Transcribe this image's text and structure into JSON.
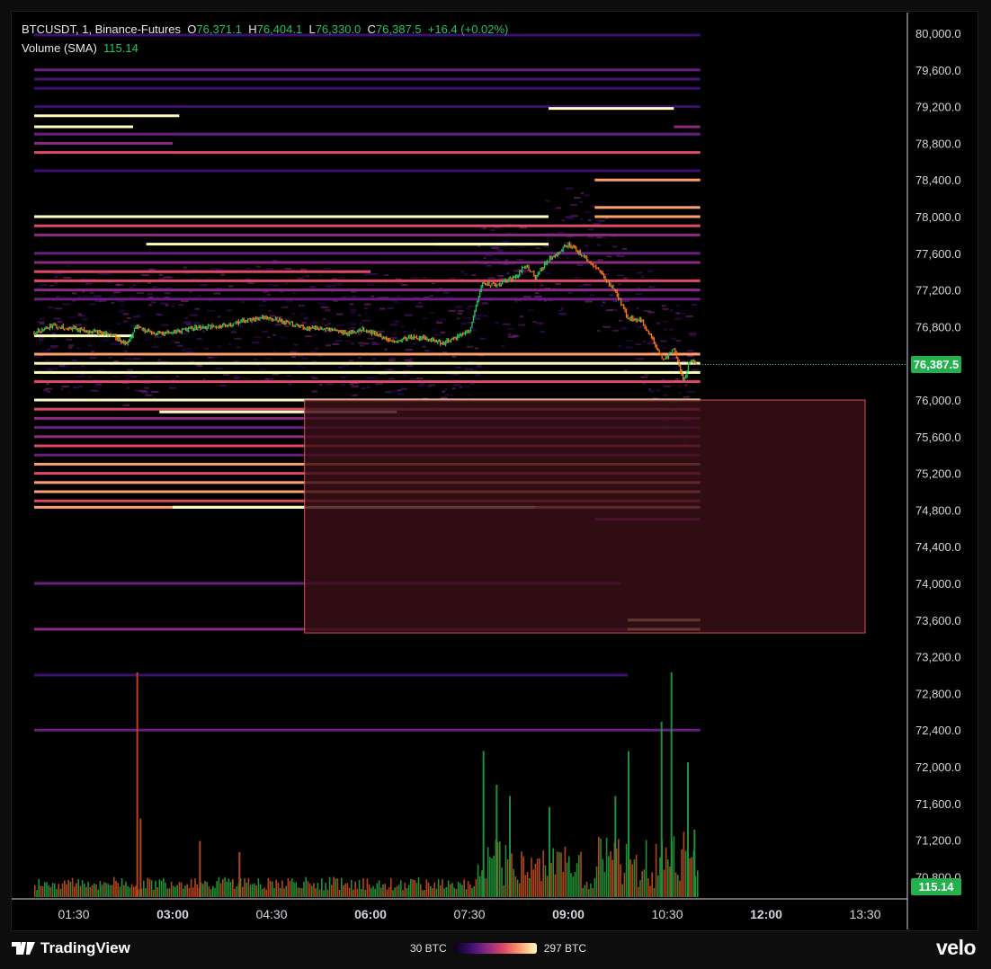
{
  "legend": {
    "symbol": "BTCUSDT, 1, Binance-Futures",
    "o_label": "O",
    "o_value": "76,371.1",
    "h_label": "H",
    "h_value": "76,404.1",
    "l_label": "L",
    "l_value": "76,330.0",
    "c_label": "C",
    "c_value": "76,387.5",
    "change": "+16.4 (+0.02%)",
    "volume_label": "Volume (SMA)",
    "volume_value": "115.14"
  },
  "price_tag": "76,387.5",
  "volume_tag": "115.14",
  "footer": {
    "brand": "TradingView",
    "scale_min": "30 BTC",
    "scale_max": "297 BTC",
    "watermark": "velo"
  },
  "colors": {
    "up": "#22c55e",
    "down": "#f97316",
    "zone_fill": "#3a0f17",
    "zone_border": "#d9534f"
  },
  "chart_data": {
    "type": "candlestick-heatmap",
    "y_ticks": [
      "80,000.0",
      "79,600.0",
      "79,200.0",
      "78,800.0",
      "78,400.0",
      "78,000.0",
      "77,600.0",
      "77,200.0",
      "76,800.0",
      "76,400.0",
      "76,000.0",
      "75,600.0",
      "75,200.0",
      "74,800.0",
      "74,400.0",
      "74,000.0",
      "73,600.0",
      "73,200.0",
      "72,800.0",
      "72,400.0",
      "72,000.0",
      "71,600.0",
      "71,200.0",
      "70,800.0"
    ],
    "x_ticks": [
      {
        "label": "01:30",
        "bold": false
      },
      {
        "label": "03:00",
        "bold": true
      },
      {
        "label": "04:30",
        "bold": false
      },
      {
        "label": "06:00",
        "bold": true
      },
      {
        "label": "07:30",
        "bold": false
      },
      {
        "label": "09:00",
        "bold": true
      },
      {
        "label": "10:30",
        "bold": false
      },
      {
        "label": "12:00",
        "bold": true
      },
      {
        "label": "13:30",
        "bold": false
      }
    ],
    "x_hours": [
      1.5,
      3,
      4.5,
      6,
      7.5,
      9,
      10.5,
      12,
      13.5
    ],
    "y_range": [
      70600,
      80100
    ],
    "last_close": 76387.5,
    "price_path": [
      [
        0.9,
        76740
      ],
      [
        1.2,
        76810
      ],
      [
        1.5,
        76780
      ],
      [
        1.8,
        76750
      ],
      [
        2.1,
        76700
      ],
      [
        2.3,
        76610
      ],
      [
        2.45,
        76800
      ],
      [
        2.7,
        76720
      ],
      [
        3.0,
        76740
      ],
      [
        3.3,
        76790
      ],
      [
        3.7,
        76800
      ],
      [
        4.0,
        76850
      ],
      [
        4.4,
        76910
      ],
      [
        4.7,
        76850
      ],
      [
        5.0,
        76790
      ],
      [
        5.3,
        76780
      ],
      [
        5.6,
        76730
      ],
      [
        5.9,
        76770
      ],
      [
        6.1,
        76720
      ],
      [
        6.3,
        76630
      ],
      [
        6.6,
        76680
      ],
      [
        6.9,
        76670
      ],
      [
        7.1,
        76620
      ],
      [
        7.3,
        76680
      ],
      [
        7.5,
        76760
      ],
      [
        7.7,
        77280
      ],
      [
        7.9,
        77250
      ],
      [
        8.2,
        77340
      ],
      [
        8.35,
        77470
      ],
      [
        8.5,
        77350
      ],
      [
        8.7,
        77530
      ],
      [
        8.9,
        77640
      ],
      [
        9.0,
        77700
      ],
      [
        9.3,
        77520
      ],
      [
        9.5,
        77380
      ],
      [
        9.7,
        77200
      ],
      [
        9.9,
        76900
      ],
      [
        10.1,
        76870
      ],
      [
        10.3,
        76640
      ],
      [
        10.45,
        76420
      ],
      [
        10.6,
        76560
      ],
      [
        10.75,
        76200
      ],
      [
        10.85,
        76450
      ],
      [
        10.95,
        76390
      ]
    ],
    "zone": {
      "x_start_hour": 5.0,
      "x_end_hour": 13.5,
      "price_top": 76000,
      "price_bottom": 73460
    },
    "current_price_line": 76387.5,
    "liquidity_levels": [
      {
        "price": 79980,
        "from": 0.9,
        "to": 11.0,
        "color": "#3b0f70"
      },
      {
        "price": 79600,
        "from": 0.9,
        "to": 11.0,
        "color": "#6a1f80"
      },
      {
        "price": 79500,
        "from": 0.9,
        "to": 11.0,
        "color": "#4a1372"
      },
      {
        "price": 79400,
        "from": 0.9,
        "to": 11.0,
        "color": "#3b0f70"
      },
      {
        "price": 79200,
        "from": 0.9,
        "to": 11.0,
        "color": "#3b0f70"
      },
      {
        "price": 79180,
        "from": 8.7,
        "to": 10.6,
        "color": "#fcfdbf"
      },
      {
        "price": 79100,
        "from": 0.9,
        "to": 3.1,
        "color": "#fcfdbf"
      },
      {
        "price": 78980,
        "from": 0.9,
        "to": 2.4,
        "color": "#fcfdbf"
      },
      {
        "price": 78980,
        "from": 10.6,
        "to": 11.0,
        "color": "#8c2981"
      },
      {
        "price": 78900,
        "from": 0.9,
        "to": 11.0,
        "color": "#6a1f80"
      },
      {
        "price": 78800,
        "from": 0.9,
        "to": 3.0,
        "color": "#8c2981"
      },
      {
        "price": 78700,
        "from": 0.9,
        "to": 11.0,
        "color": "#de4968"
      },
      {
        "price": 78500,
        "from": 0.9,
        "to": 11.0,
        "color": "#3b0f70"
      },
      {
        "price": 78400,
        "from": 9.4,
        "to": 11.0,
        "color": "#fe9f6d"
      },
      {
        "price": 78100,
        "from": 9.4,
        "to": 11.0,
        "color": "#fe9f6d"
      },
      {
        "price": 78000,
        "from": 0.9,
        "to": 8.7,
        "color": "#fcfdbf"
      },
      {
        "price": 78000,
        "from": 9.4,
        "to": 11.0,
        "color": "#fe9f6d"
      },
      {
        "price": 77900,
        "from": 0.9,
        "to": 11.0,
        "color": "#de4968"
      },
      {
        "price": 77800,
        "from": 0.9,
        "to": 11.0,
        "color": "#8c2981"
      },
      {
        "price": 77700,
        "from": 2.6,
        "to": 8.7,
        "color": "#fcfdbf"
      },
      {
        "price": 77700,
        "from": 7.0,
        "to": 8.5,
        "color": "#fcfdbf"
      },
      {
        "price": 77600,
        "from": 0.9,
        "to": 11.0,
        "color": "#6a1f80"
      },
      {
        "price": 77500,
        "from": 0.9,
        "to": 11.0,
        "color": "#8c2981"
      },
      {
        "price": 77400,
        "from": 0.9,
        "to": 6.0,
        "color": "#de4968"
      },
      {
        "price": 77300,
        "from": 0.9,
        "to": 11.0,
        "color": "#de4968"
      },
      {
        "price": 77200,
        "from": 0.9,
        "to": 11.0,
        "color": "#8c2981"
      },
      {
        "price": 77100,
        "from": 0.9,
        "to": 11.0,
        "color": "#6a1f80"
      },
      {
        "price": 76700,
        "from": 0.9,
        "to": 2.4,
        "color": "#fcfdbf"
      },
      {
        "price": 76500,
        "from": 0.9,
        "to": 11.0,
        "color": "#fe9f6d"
      },
      {
        "price": 76400,
        "from": 0.9,
        "to": 11.0,
        "color": "#fcfdbf"
      },
      {
        "price": 76300,
        "from": 0.9,
        "to": 11.0,
        "color": "#fcfdbf"
      },
      {
        "price": 76200,
        "from": 0.9,
        "to": 11.0,
        "color": "#de4968"
      },
      {
        "price": 76000,
        "from": 0.9,
        "to": 11.0,
        "color": "#fcfdbf"
      },
      {
        "price": 75900,
        "from": 0.9,
        "to": 11.0,
        "color": "#de4968"
      },
      {
        "price": 75870,
        "from": 2.8,
        "to": 6.4,
        "color": "#fcfdbf"
      },
      {
        "price": 75800,
        "from": 0.9,
        "to": 11.0,
        "color": "#8c2981"
      },
      {
        "price": 75700,
        "from": 0.9,
        "to": 11.0,
        "color": "#6a1f80"
      },
      {
        "price": 75600,
        "from": 0.9,
        "to": 11.0,
        "color": "#8c2981"
      },
      {
        "price": 75500,
        "from": 0.9,
        "to": 11.0,
        "color": "#de4968"
      },
      {
        "price": 75400,
        "from": 0.9,
        "to": 11.0,
        "color": "#6a1f80"
      },
      {
        "price": 75300,
        "from": 0.9,
        "to": 11.0,
        "color": "#fe9f6d"
      },
      {
        "price": 75200,
        "from": 0.9,
        "to": 11.0,
        "color": "#de4968"
      },
      {
        "price": 75100,
        "from": 0.9,
        "to": 11.0,
        "color": "#fe9f6d"
      },
      {
        "price": 75000,
        "from": 0.9,
        "to": 11.0,
        "color": "#fe9f6d"
      },
      {
        "price": 74900,
        "from": 0.9,
        "to": 11.0,
        "color": "#de4968"
      },
      {
        "price": 74830,
        "from": 0.9,
        "to": 11.0,
        "color": "#fe9f6d"
      },
      {
        "price": 74830,
        "from": 3.0,
        "to": 8.5,
        "color": "#fcfdbf"
      },
      {
        "price": 74700,
        "from": 9.4,
        "to": 11.0,
        "color": "#8c2981"
      },
      {
        "price": 74000,
        "from": 0.9,
        "to": 9.8,
        "color": "#6a1f80"
      },
      {
        "price": 73600,
        "from": 9.9,
        "to": 11.0,
        "color": "#fcfdbf"
      },
      {
        "price": 73500,
        "from": 0.9,
        "to": 11.0,
        "color": "#8c2981"
      },
      {
        "price": 73500,
        "from": 9.9,
        "to": 11.0,
        "color": "#fcfdbf"
      },
      {
        "price": 73000,
        "from": 0.9,
        "to": 9.9,
        "color": "#3b0f70"
      },
      {
        "price": 72400,
        "from": 0.9,
        "to": 11.0,
        "color": "#6a1f80"
      }
    ],
    "volume_spikes": [
      {
        "hour": 2.45,
        "value": 1.0
      },
      {
        "hour": 2.5,
        "value": 0.35
      },
      {
        "hour": 3.4,
        "value": 0.25
      },
      {
        "hour": 4.0,
        "value": 0.2
      },
      {
        "hour": 7.7,
        "value": 0.65
      },
      {
        "hour": 7.9,
        "value": 0.5
      },
      {
        "hour": 8.1,
        "value": 0.45
      },
      {
        "hour": 8.7,
        "value": 0.4
      },
      {
        "hour": 9.7,
        "value": 0.45
      },
      {
        "hour": 9.9,
        "value": 0.65
      },
      {
        "hour": 10.4,
        "value": 0.78
      },
      {
        "hour": 10.55,
        "value": 1.0
      },
      {
        "hour": 10.8,
        "value": 0.6
      },
      {
        "hour": 10.9,
        "value": 0.3
      }
    ]
  }
}
